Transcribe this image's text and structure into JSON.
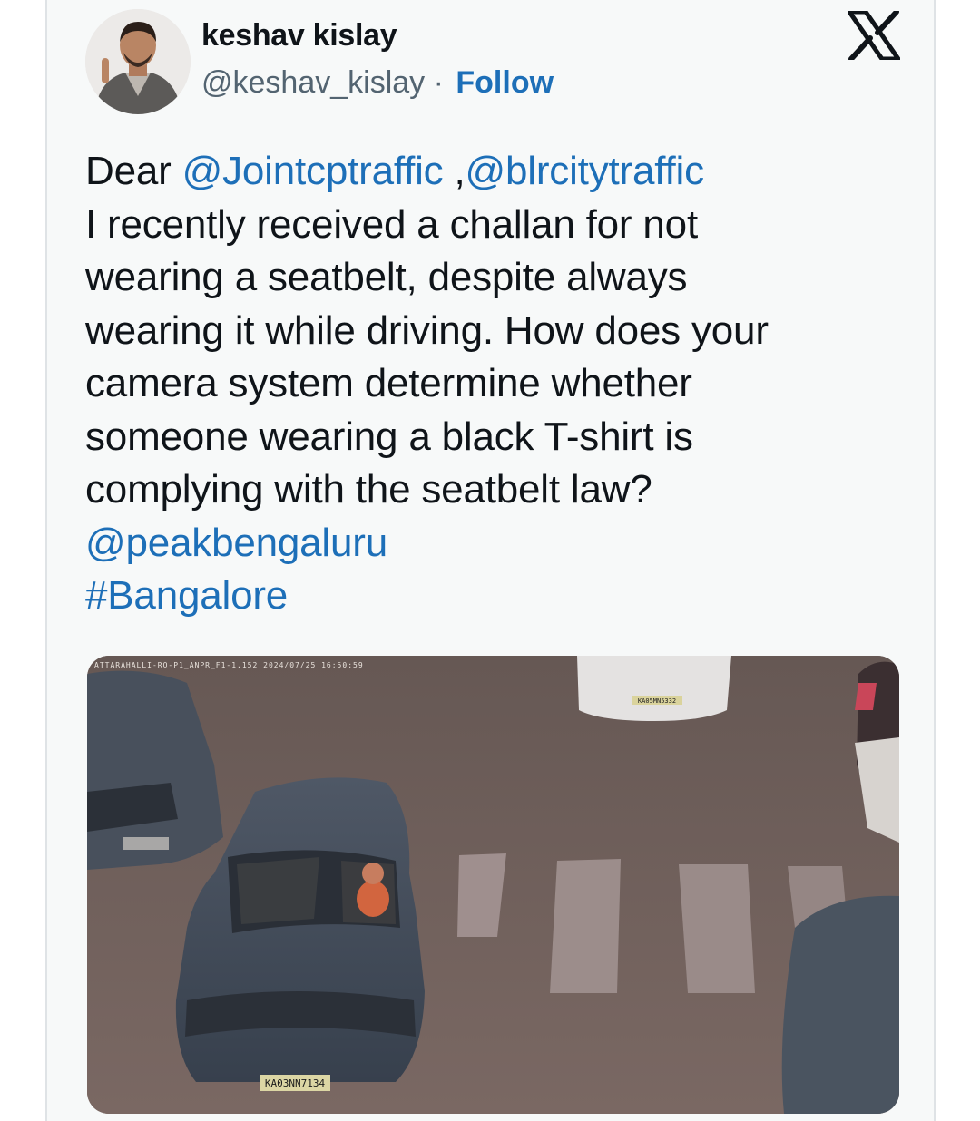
{
  "author": {
    "name": "keshav kislay",
    "handle": "@keshav_kislay",
    "separator": " · ",
    "follow_label": "Follow"
  },
  "platform_icon": "x-logo-icon",
  "post": {
    "greeting": "Dear ",
    "mention_1": "@Jointcptraffic",
    "separator": " ,",
    "mention_2": "@blrcitytraffic",
    "body_lines": [
      "I recently received a challan for not",
      "wearing a seatbelt, despite always",
      "wearing it while driving. How does your",
      "camera system determine whether",
      "someone wearing a black T-shirt is",
      "complying with the seatbelt law?"
    ],
    "mention_3": "@peakbengaluru",
    "hashtag": "#Bangalore"
  },
  "photo": {
    "camera_overlay": "ATTARAHALLI-RO-P1_ANPR_F1-1.152 2024/07/25 16:50:59",
    "plate_main": "KA03NN7134",
    "plate_top": "KA05MN5332"
  },
  "colors": {
    "link": "#1d6fb8",
    "card_bg": "#f7f9f9",
    "road": "#6f5e5a"
  }
}
